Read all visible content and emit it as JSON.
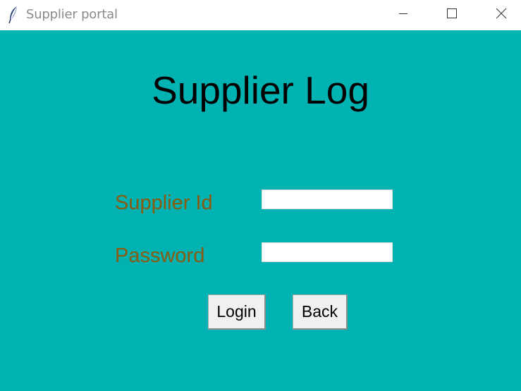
{
  "window": {
    "title": "Supplier portal",
    "app_icon": "feather-icon",
    "controls": {
      "minimize_icon": "minimize-icon",
      "maximize_icon": "maximize-icon",
      "close_icon": "close-icon"
    }
  },
  "form": {
    "heading": "Supplier Log",
    "supplier_id_label": "Supplier Id",
    "supplier_id_value": "",
    "password_label": "Password",
    "password_value": "",
    "login_label": "Login",
    "back_label": "Back"
  },
  "colors": {
    "background": "#00b2b2",
    "label_text": "#8a5a0e",
    "heading_text": "#000000",
    "titlebar": "#ffffff"
  }
}
